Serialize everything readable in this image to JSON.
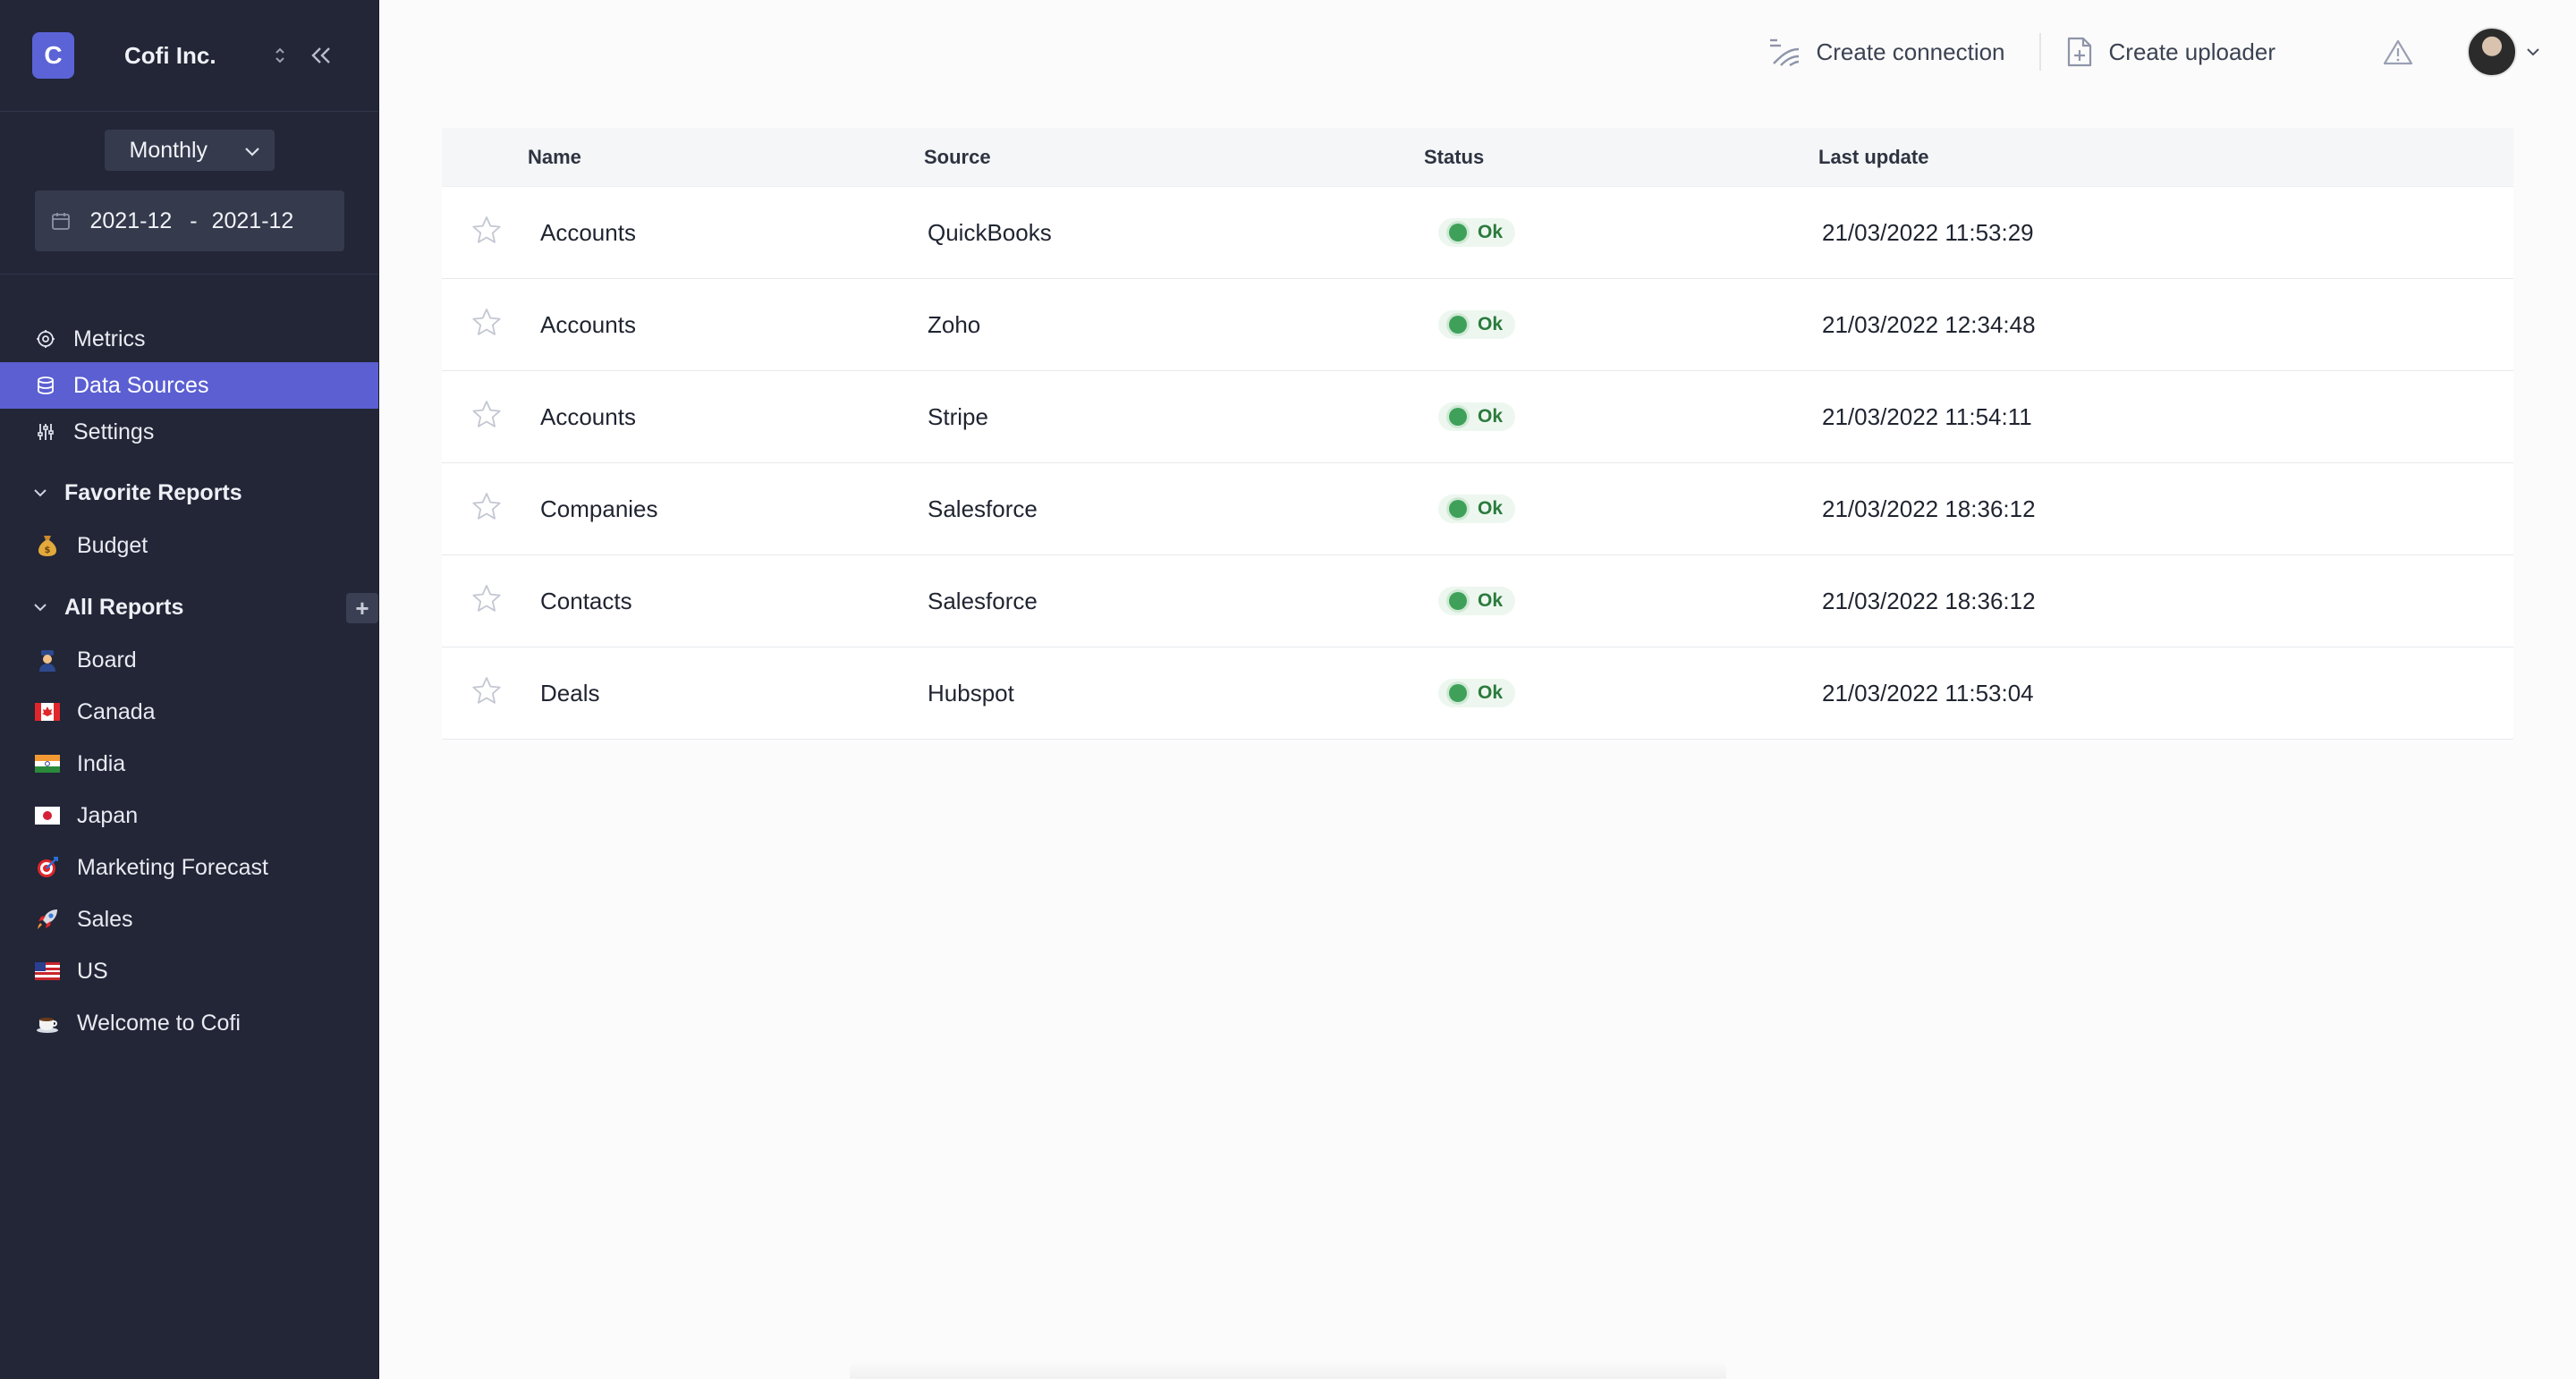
{
  "org": {
    "initial": "C",
    "name": "Cofi Inc."
  },
  "period": {
    "value": "Monthly",
    "start": "2021-12",
    "separator": "-",
    "end": "2021-12"
  },
  "nav": [
    {
      "key": "metrics",
      "label": "Metrics",
      "icon": "metrics-icon",
      "active": false
    },
    {
      "key": "data-sources",
      "label": "Data Sources",
      "icon": "database-icon",
      "active": true
    },
    {
      "key": "settings",
      "label": "Settings",
      "icon": "sliders-icon",
      "active": false
    }
  ],
  "favorites": {
    "title": "Favorite Reports",
    "items": [
      {
        "label": "Budget",
        "icon": "money-bag-icon"
      }
    ]
  },
  "all_reports": {
    "title": "All Reports",
    "add_label": "+",
    "items": [
      {
        "label": "Board",
        "icon": "officer-icon"
      },
      {
        "label": "Canada",
        "icon": "canada-flag-icon"
      },
      {
        "label": "India",
        "icon": "india-flag-icon"
      },
      {
        "label": "Japan",
        "icon": "japan-flag-icon"
      },
      {
        "label": "Marketing Forecast",
        "icon": "target-icon"
      },
      {
        "label": "Sales",
        "icon": "rocket-icon"
      },
      {
        "label": "US",
        "icon": "us-flag-icon"
      },
      {
        "label": "Welcome to Cofi",
        "icon": "coffee-icon"
      }
    ]
  },
  "toolbar": {
    "create_connection": "Create connection",
    "create_uploader": "Create uploader"
  },
  "table": {
    "columns": {
      "name": "Name",
      "source": "Source",
      "status": "Status",
      "last_update": "Last update"
    },
    "rows": [
      {
        "name": "Accounts",
        "source": "QuickBooks",
        "status": "Ok",
        "last_update": "21/03/2022 11:53:29"
      },
      {
        "name": "Accounts",
        "source": "Zoho",
        "status": "Ok",
        "last_update": "21/03/2022 12:34:48"
      },
      {
        "name": "Accounts",
        "source": "Stripe",
        "status": "Ok",
        "last_update": "21/03/2022 11:54:11"
      },
      {
        "name": "Companies",
        "source": "Salesforce",
        "status": "Ok",
        "last_update": "21/03/2022 18:36:12"
      },
      {
        "name": "Contacts",
        "source": "Salesforce",
        "status": "Ok",
        "last_update": "21/03/2022 18:36:12"
      },
      {
        "name": "Deals",
        "source": "Hubspot",
        "status": "Ok",
        "last_update": "21/03/2022 11:53:04"
      }
    ]
  },
  "colors": {
    "sidebar": "#222637",
    "accent": "#5b5fd2",
    "status_ok": "#3fa159"
  }
}
